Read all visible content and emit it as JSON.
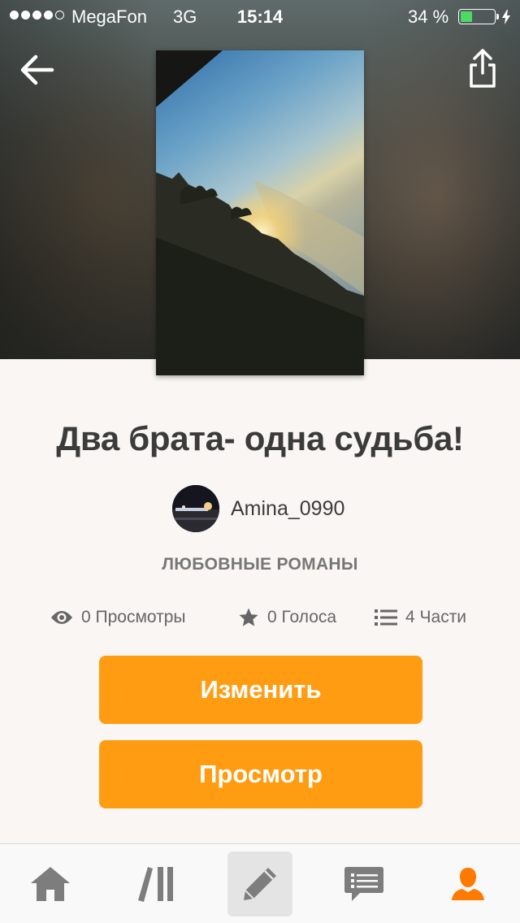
{
  "status_bar": {
    "carrier": "MegaFon",
    "network": "3G",
    "time": "15:14",
    "battery_percent": "34 %",
    "battery_level": 0.34,
    "signal_bars": 4
  },
  "header": {
    "back_icon": "arrow-left-icon",
    "share_icon": "share-icon"
  },
  "story": {
    "title": "Два брата- одна судьба!",
    "author": "Amina_0990",
    "category": "ЛЮБОВНЫЕ РОМАНЫ",
    "stats": {
      "reads": "0 Просмотры",
      "votes": "0 Голоса",
      "parts": "4 Части"
    }
  },
  "actions": {
    "edit_label": "Изменить",
    "preview_label": "Просмотр"
  },
  "tab_bar": {
    "items": [
      {
        "icon": "home-icon",
        "active": false
      },
      {
        "icon": "library-icon",
        "active": false
      },
      {
        "icon": "pencil-icon",
        "active": false,
        "highlighted": true
      },
      {
        "icon": "chat-icon",
        "active": false
      },
      {
        "icon": "profile-icon",
        "active": true
      }
    ]
  },
  "colors": {
    "accent": "#ff9c12",
    "background": "#f9f6f3",
    "text": "#3b3b3b",
    "muted": "#777777",
    "tab_inactive": "#7d7d7d",
    "tab_active": "#ff7a00",
    "battery": "#4cd964"
  }
}
